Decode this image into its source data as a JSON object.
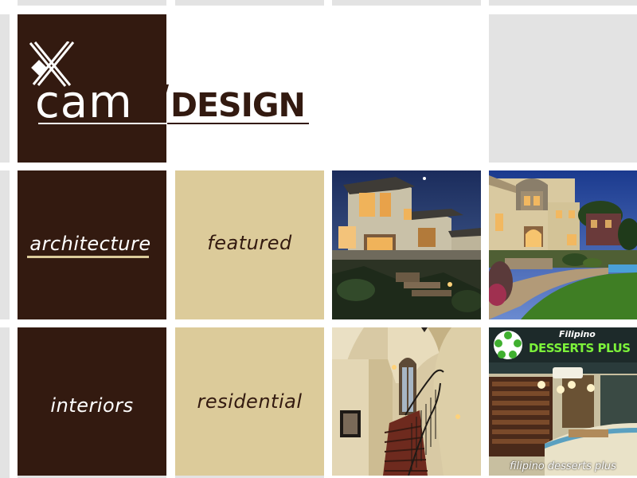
{
  "brand": {
    "cam": "cam",
    "design": "DESIGN"
  },
  "nav": {
    "architecture": "architecture",
    "featured": "featured",
    "interiors": "interiors",
    "residential": "residential"
  },
  "photos": {
    "modern_house": {
      "icon": "modern-house-dusk-photo"
    },
    "villa_garden": {
      "icon": "villa-garden-photo"
    },
    "staircase": {
      "icon": "spiral-staircase-interior-photo"
    },
    "desserts_shop": {
      "icon": "dessert-shop-photo",
      "sign_top": "Filipino",
      "sign_main": "DESSERTS PLUS",
      "caption": "filipino desserts plus"
    }
  },
  "colors": {
    "brown": "#331a10",
    "tan": "#dccb9a",
    "grey": "#e3e3e3"
  }
}
